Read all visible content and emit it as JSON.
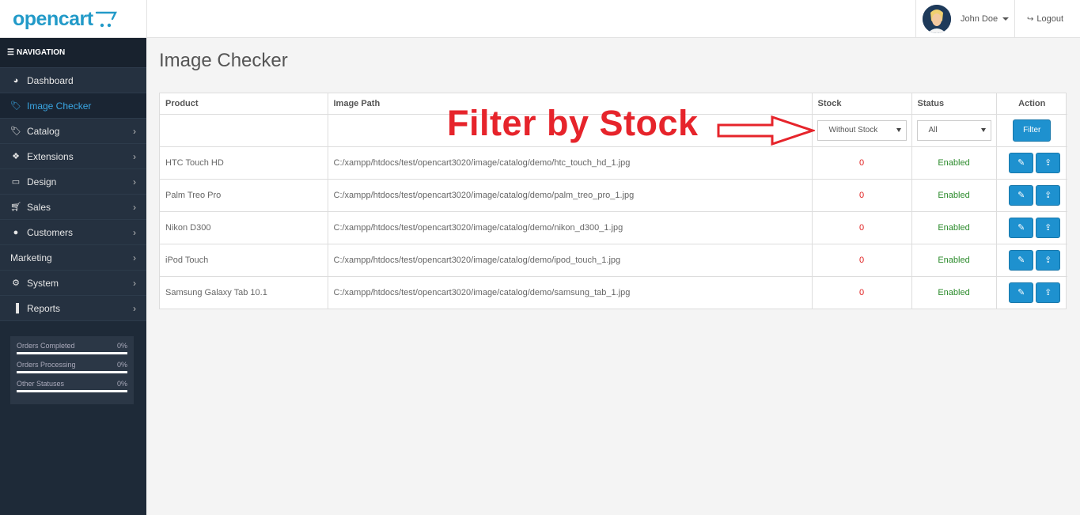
{
  "header": {
    "logo": "opencart",
    "user_name": "John Doe",
    "logout_label": "Logout"
  },
  "sidebar": {
    "heading": "NAVIGATION",
    "items": [
      {
        "label": "Dashboard",
        "icon": "dashboard-icon",
        "arrow": false
      },
      {
        "label": "Image Checker",
        "icon": "tags-icon",
        "arrow": false,
        "active": true
      },
      {
        "label": "Catalog",
        "icon": "tag-icon",
        "arrow": true
      },
      {
        "label": "Extensions",
        "icon": "puzzle-icon",
        "arrow": true
      },
      {
        "label": "Design",
        "icon": "monitor-icon",
        "arrow": true
      },
      {
        "label": "Sales",
        "icon": "cart-icon",
        "arrow": true
      },
      {
        "label": "Customers",
        "icon": "user-icon",
        "arrow": true
      },
      {
        "label": "Marketing",
        "icon": "",
        "arrow": true
      },
      {
        "label": "System",
        "icon": "cog-icon",
        "arrow": true
      },
      {
        "label": "Reports",
        "icon": "bar-chart-icon",
        "arrow": true
      }
    ],
    "stats": [
      {
        "label": "Orders Completed",
        "value": "0%"
      },
      {
        "label": "Orders Processing",
        "value": "0%"
      },
      {
        "label": "Other Statuses",
        "value": "0%"
      }
    ]
  },
  "main": {
    "title": "Image Checker",
    "columns": [
      "Product",
      "Image Path",
      "Stock",
      "Status",
      "Action"
    ],
    "filters": {
      "stock_selected": "Without Stock",
      "status_selected": "All",
      "filter_button": "Filter"
    },
    "rows": [
      {
        "product": "HTC Touch HD",
        "path": "C:/xampp/htdocs/test/opencart3020/image/catalog/demo/htc_touch_hd_1.jpg",
        "stock": "0",
        "status": "Enabled"
      },
      {
        "product": "Palm Treo Pro",
        "path": "C:/xampp/htdocs/test/opencart3020/image/catalog/demo/palm_treo_pro_1.jpg",
        "stock": "0",
        "status": "Enabled"
      },
      {
        "product": "Nikon D300",
        "path": "C:/xampp/htdocs/test/opencart3020/image/catalog/demo/nikon_d300_1.jpg",
        "stock": "0",
        "status": "Enabled"
      },
      {
        "product": "iPod Touch",
        "path": "C:/xampp/htdocs/test/opencart3020/image/catalog/demo/ipod_touch_1.jpg",
        "stock": "0",
        "status": "Enabled"
      },
      {
        "product": "Samsung Galaxy Tab 10.1",
        "path": "C:/xampp/htdocs/test/opencart3020/image/catalog/demo/samsung_tab_1.jpg",
        "stock": "0",
        "status": "Enabled"
      }
    ]
  },
  "annotation": {
    "text": "Filter by Stock",
    "color": "#e6242b"
  },
  "colors": {
    "brand": "#229ac8",
    "button": "#1e91cf",
    "sidebar": "#1e2a38",
    "active_link": "#3aa7e4"
  }
}
